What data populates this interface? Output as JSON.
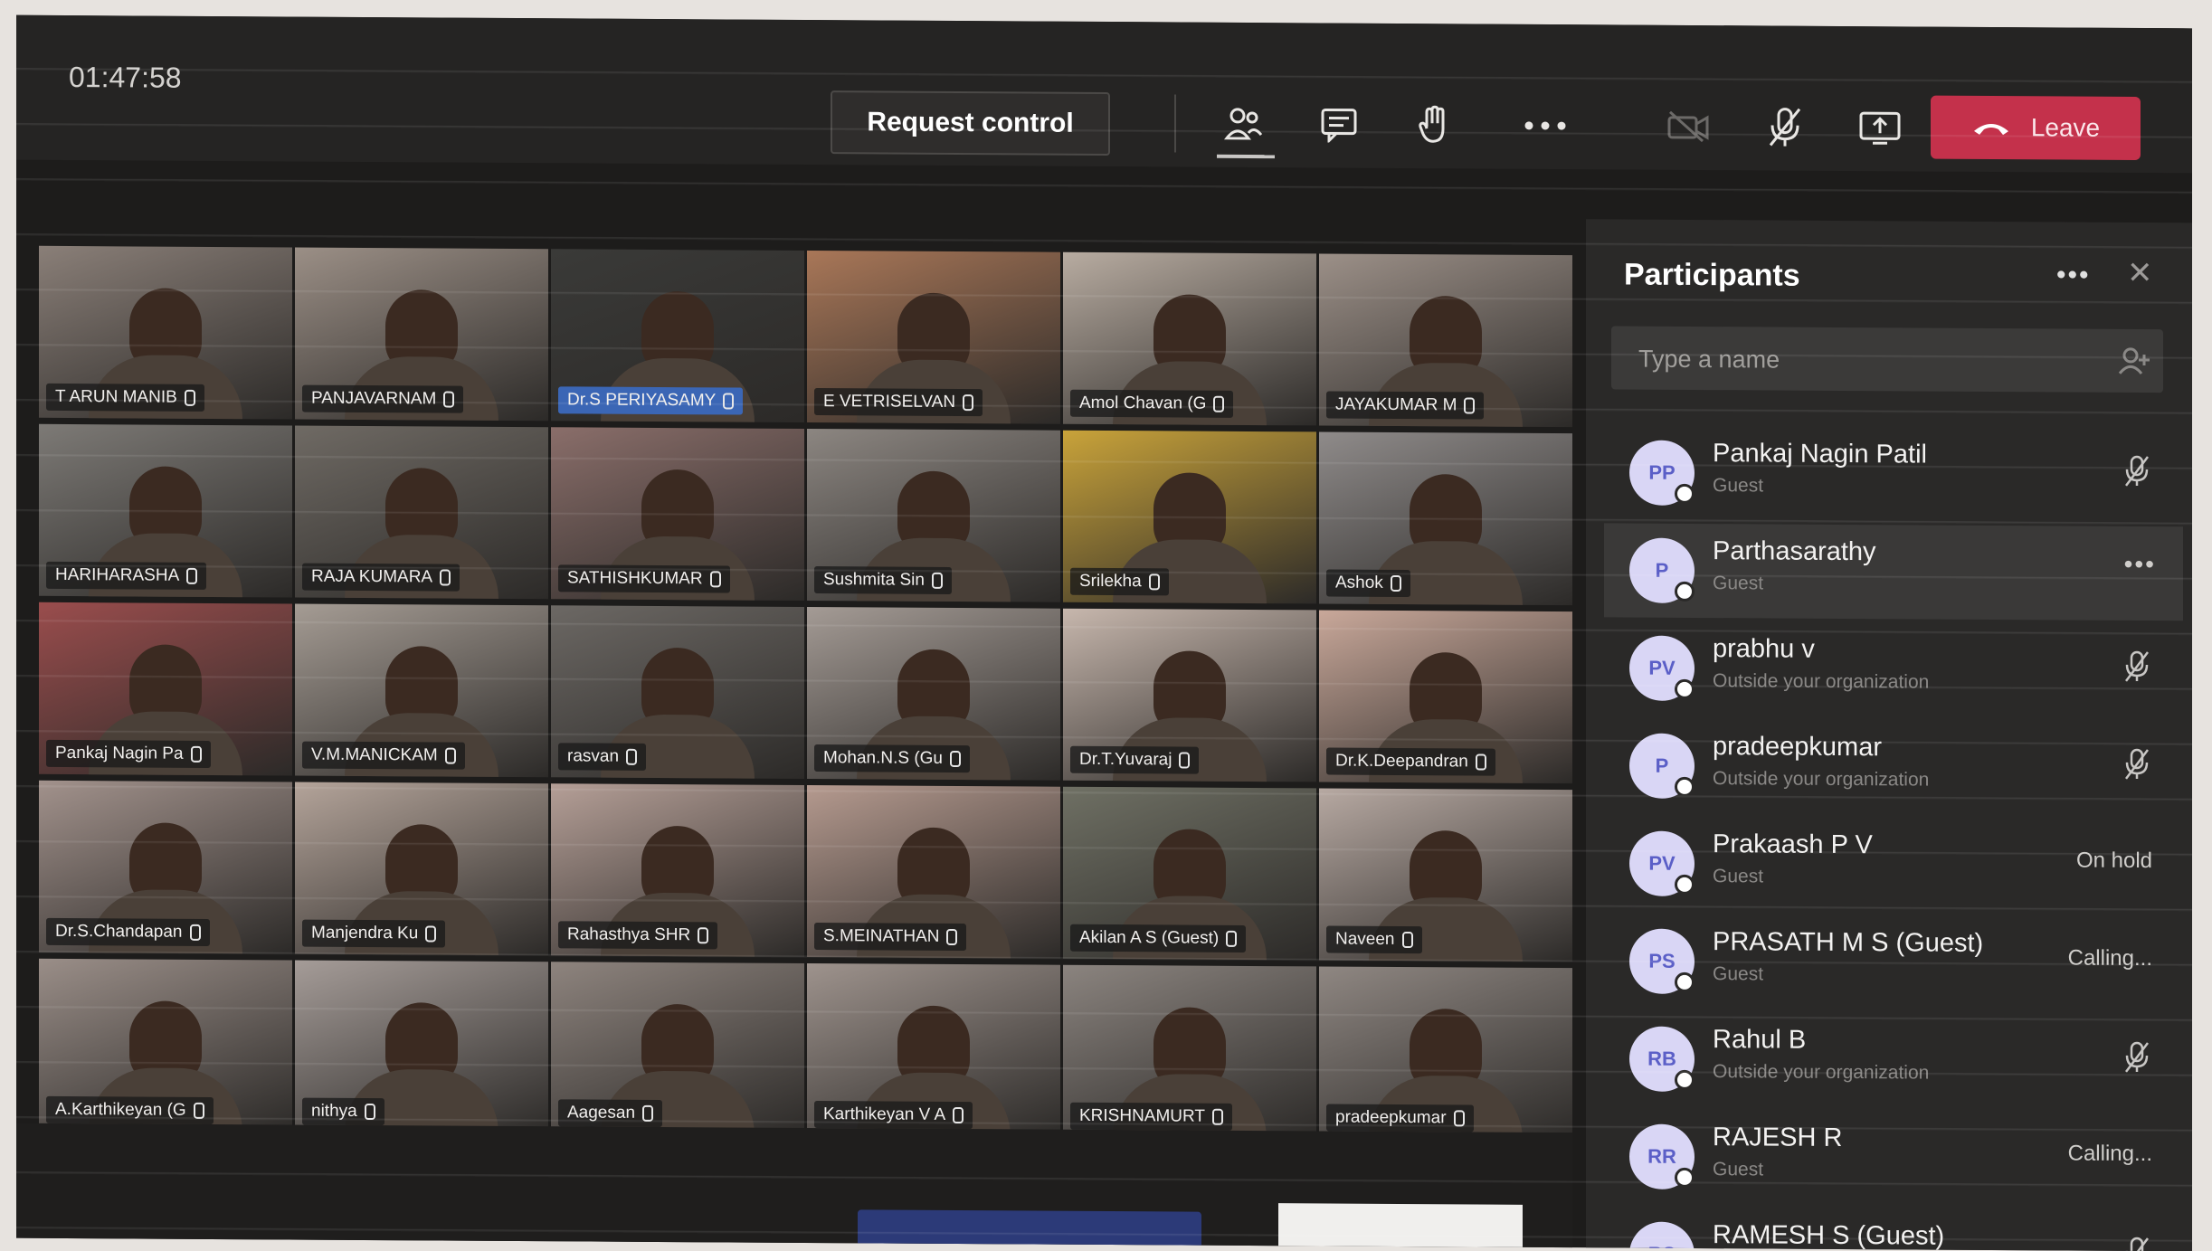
{
  "meeting": {
    "timer": "01:47:58",
    "request_control_label": "Request control",
    "leave_label": "Leave"
  },
  "colors": {
    "leave": "#c4314b",
    "background": "#1d1c1b",
    "avatar": "#d9d6f5"
  },
  "toolbar_icons": [
    "people-icon",
    "chat-icon",
    "raise-hand-icon",
    "more-icon",
    "camera-off-icon",
    "mic-off-icon",
    "share-screen-icon"
  ],
  "tiles": [
    {
      "name": "T ARUN MANIB",
      "tone": "#8a7f78",
      "blue": false
    },
    {
      "name": "PANJAVARNAM",
      "tone": "#9b8f86",
      "blue": false
    },
    {
      "name": "Dr.S PERIYASAMY",
      "tone": "#3a3a38",
      "blue": true
    },
    {
      "name": "E VETRISELVAN",
      "tone": "#a97758",
      "blue": false
    },
    {
      "name": "Amol Chavan (G",
      "tone": "#b8aca1",
      "blue": false
    },
    {
      "name": "JAYAKUMAR M",
      "tone": "#9c9088",
      "blue": false
    },
    {
      "name": "HARIHARASHA",
      "tone": "#7d7a76",
      "blue": false
    },
    {
      "name": "RAJA KUMARA",
      "tone": "#6f6a64",
      "blue": false
    },
    {
      "name": "SATHISHKUMAR",
      "tone": "#8a6e6a",
      "blue": false
    },
    {
      "name": "Sushmita Sin",
      "tone": "#8c8681",
      "blue": false
    },
    {
      "name": "Srilekha",
      "tone": "#c9a33a",
      "blue": false
    },
    {
      "name": "Ashok",
      "tone": "#8f8b8a",
      "blue": false
    },
    {
      "name": "Pankaj Nagin Pa",
      "tone": "#9a4d4d",
      "blue": false
    },
    {
      "name": "V.M.MANICKAM",
      "tone": "#a59c94",
      "blue": false
    },
    {
      "name": "rasvan",
      "tone": "#6c6864",
      "blue": false
    },
    {
      "name": "Mohan.N.S (Gu",
      "tone": "#a49b95",
      "blue": false
    },
    {
      "name": "Dr.T.Yuvaraj",
      "tone": "#c7b7ad",
      "blue": false
    },
    {
      "name": "Dr.K.Deepandran",
      "tone": "#c9a89a",
      "blue": false
    },
    {
      "name": "Dr.S.Chandapan",
      "tone": "#a2928c",
      "blue": false
    },
    {
      "name": "Manjendra Ku",
      "tone": "#b4a49a",
      "blue": false
    },
    {
      "name": "Rahasthya SHR",
      "tone": "#b59f97",
      "blue": false
    },
    {
      "name": "S.MEINATHAN",
      "tone": "#b59a8f",
      "blue": false
    },
    {
      "name": "Akilan A S (Guest)",
      "tone": "#6f7064",
      "blue": false
    },
    {
      "name": "Naveen",
      "tone": "#b7a9a2",
      "blue": false
    },
    {
      "name": "A.Karthikeyan (G",
      "tone": "#9a8e88",
      "blue": false
    },
    {
      "name": "nithya",
      "tone": "#a59c98",
      "blue": false
    },
    {
      "name": "Aagesan",
      "tone": "#8e847e",
      "blue": false
    },
    {
      "name": "Karthikeyan V A",
      "tone": "#9e938d",
      "blue": false
    },
    {
      "name": "KRISHNAMURT",
      "tone": "#8b847f",
      "blue": false
    },
    {
      "name": "pradeepkumar",
      "tone": "#8f8782",
      "blue": false
    }
  ],
  "panel": {
    "title": "Participants",
    "search_placeholder": "Type a name",
    "participants": [
      {
        "initials": "PP",
        "name": "Pankaj Nagin Patil",
        "sub": "Guest",
        "status": "",
        "mic": true,
        "more": false
      },
      {
        "initials": "P",
        "name": "Parthasarathy",
        "sub": "Guest",
        "status": "",
        "mic": false,
        "more": true
      },
      {
        "initials": "PV",
        "name": "prabhu v",
        "sub": "Outside your organization",
        "status": "",
        "mic": true,
        "more": false
      },
      {
        "initials": "P",
        "name": "pradeepkumar",
        "sub": "Outside your organization",
        "status": "",
        "mic": true,
        "more": false
      },
      {
        "initials": "PV",
        "name": "Prakaash P V",
        "sub": "Guest",
        "status": "On hold",
        "mic": false,
        "more": false
      },
      {
        "initials": "PS",
        "name": "PRASATH M S (Guest)",
        "sub": "Guest",
        "status": "Calling...",
        "mic": false,
        "more": false
      },
      {
        "initials": "RB",
        "name": "Rahul B",
        "sub": "Outside your organization",
        "status": "",
        "mic": true,
        "more": false
      },
      {
        "initials": "RR",
        "name": "RAJESH R",
        "sub": "Guest",
        "status": "Calling...",
        "mic": false,
        "more": false
      },
      {
        "initials": "RS",
        "name": "RAMESH S (Guest)",
        "sub": "",
        "status": "",
        "mic": true,
        "more": false
      }
    ]
  }
}
